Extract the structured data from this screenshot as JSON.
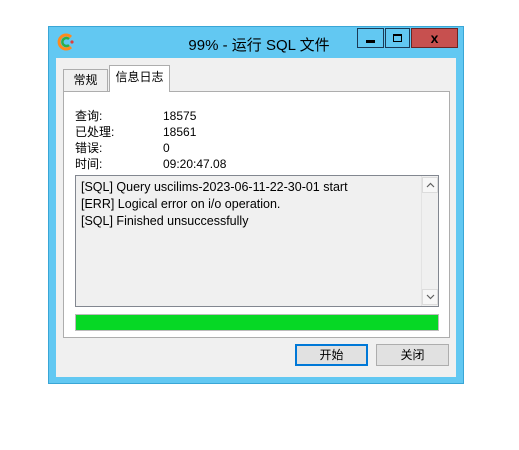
{
  "window": {
    "title": "99% - 运行 SQL 文件",
    "close_glyph": "x"
  },
  "tabs": [
    {
      "label": "常规",
      "active": false
    },
    {
      "label": "信息日志",
      "active": true
    }
  ],
  "stats": [
    {
      "label": "查询:",
      "value": "18575"
    },
    {
      "label": "已处理:",
      "value": "18561"
    },
    {
      "label": "错误:",
      "value": "0"
    },
    {
      "label": "时间:",
      "value": "09:20:47.08"
    }
  ],
  "log": {
    "lines": [
      "[SQL] Query uscilims-2023-06-11-22-30-01 start",
      "[ERR] Logical error on i/o operation.",
      "[SQL] Finished unsuccessfully"
    ]
  },
  "progress": {
    "fraction": 1.0,
    "color": "#06d825"
  },
  "buttons": {
    "start": "开始",
    "close": "关闭"
  },
  "colors": {
    "title_bar": "#62c8f2",
    "close_button": "#c7504f"
  },
  "icons": {
    "app": "navicat-icon",
    "minimize": "minimize-icon",
    "maximize": "maximize-icon",
    "close": "close-icon",
    "scroll_up": "chevron-up-icon",
    "scroll_down": "chevron-down-icon"
  }
}
